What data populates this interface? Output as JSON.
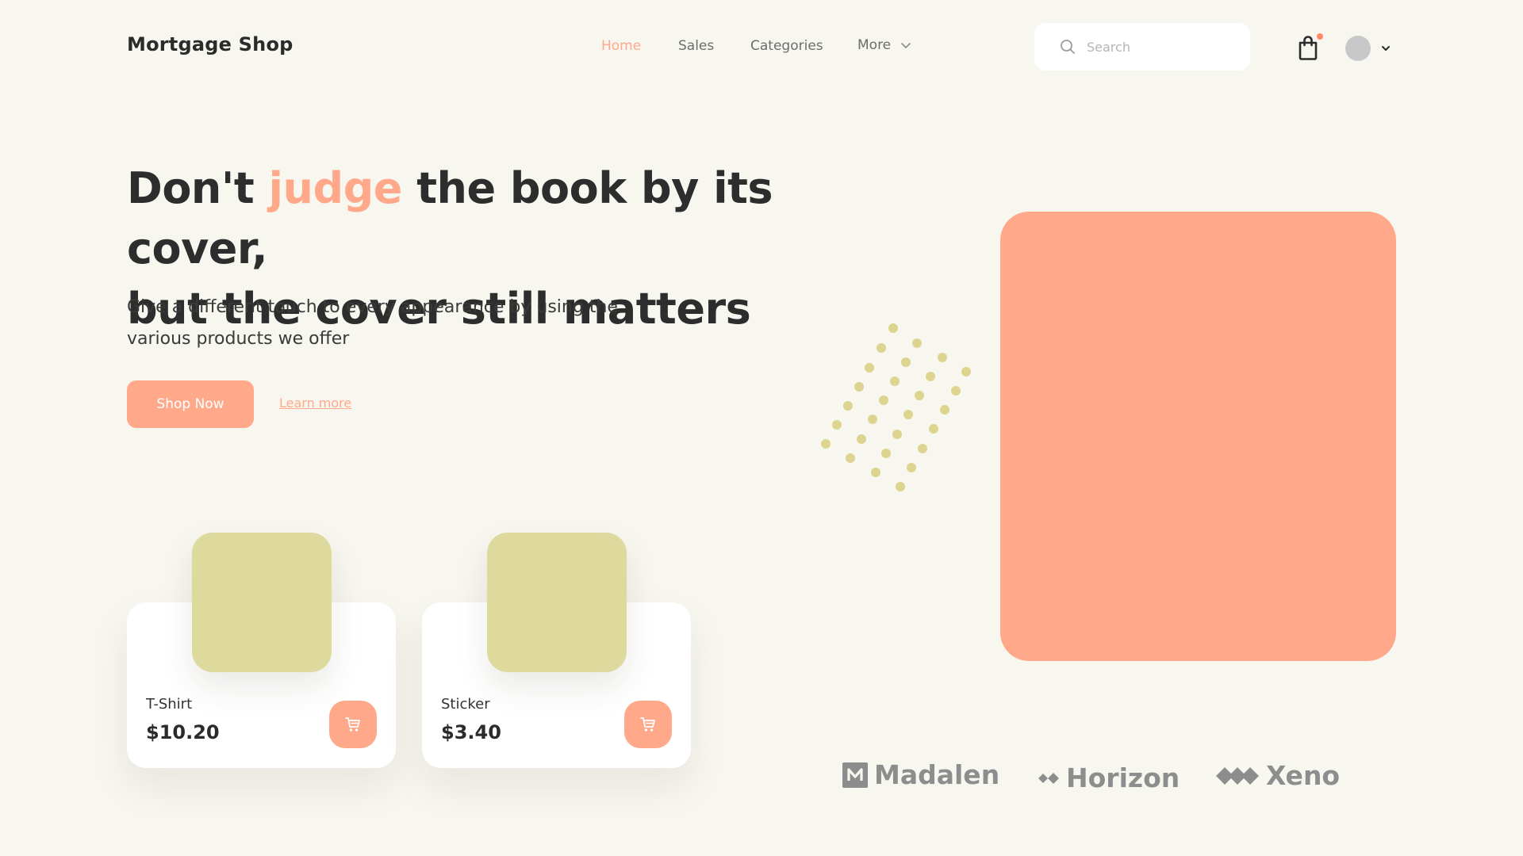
{
  "header": {
    "logo": "Mortgage Shop",
    "nav": [
      {
        "label": "Home",
        "active": true
      },
      {
        "label": "Sales",
        "active": false
      },
      {
        "label": "Categories",
        "active": false
      },
      {
        "label": "More",
        "active": false
      }
    ],
    "search": {
      "placeholder": "Search"
    },
    "cart": {
      "icon": "shopping-bag-icon",
      "has_notification": true
    },
    "user": {
      "icon": "avatar",
      "menu_icon": "chevron-down-icon"
    }
  },
  "hero": {
    "title_before": "Don't ",
    "title_accent": "judge",
    "title_line1_after": " the book by its cover,",
    "title_line2": "but the cover still matters",
    "subtitle_line1": "Give a different touch to every appearance by using the",
    "subtitle_line2": "various products we offer",
    "cta_primary": "Shop Now",
    "cta_secondary": "Learn more"
  },
  "products": [
    {
      "name": "T-Shirt",
      "price": "$10.20",
      "cart_icon": "cart-icon"
    },
    {
      "name": "Sticker",
      "price": "$3.40",
      "cart_icon": "cart-icon"
    }
  ],
  "brands": [
    {
      "name": "Madalen",
      "icon": "m-square-icon"
    },
    {
      "name": "Horizon",
      "icon": "diamond-pair-icon"
    },
    {
      "name": "Xeno",
      "icon": "triple-diamond-icon"
    }
  ],
  "colors": {
    "background": "#f7f6ef",
    "accent": "#ffa98a",
    "thumb": "#ded99d",
    "dots": "#dcd48f",
    "text_dark": "#2d2d2d",
    "text_muted": "#6d6d6d",
    "brand_gray": "#8d8d8d"
  }
}
